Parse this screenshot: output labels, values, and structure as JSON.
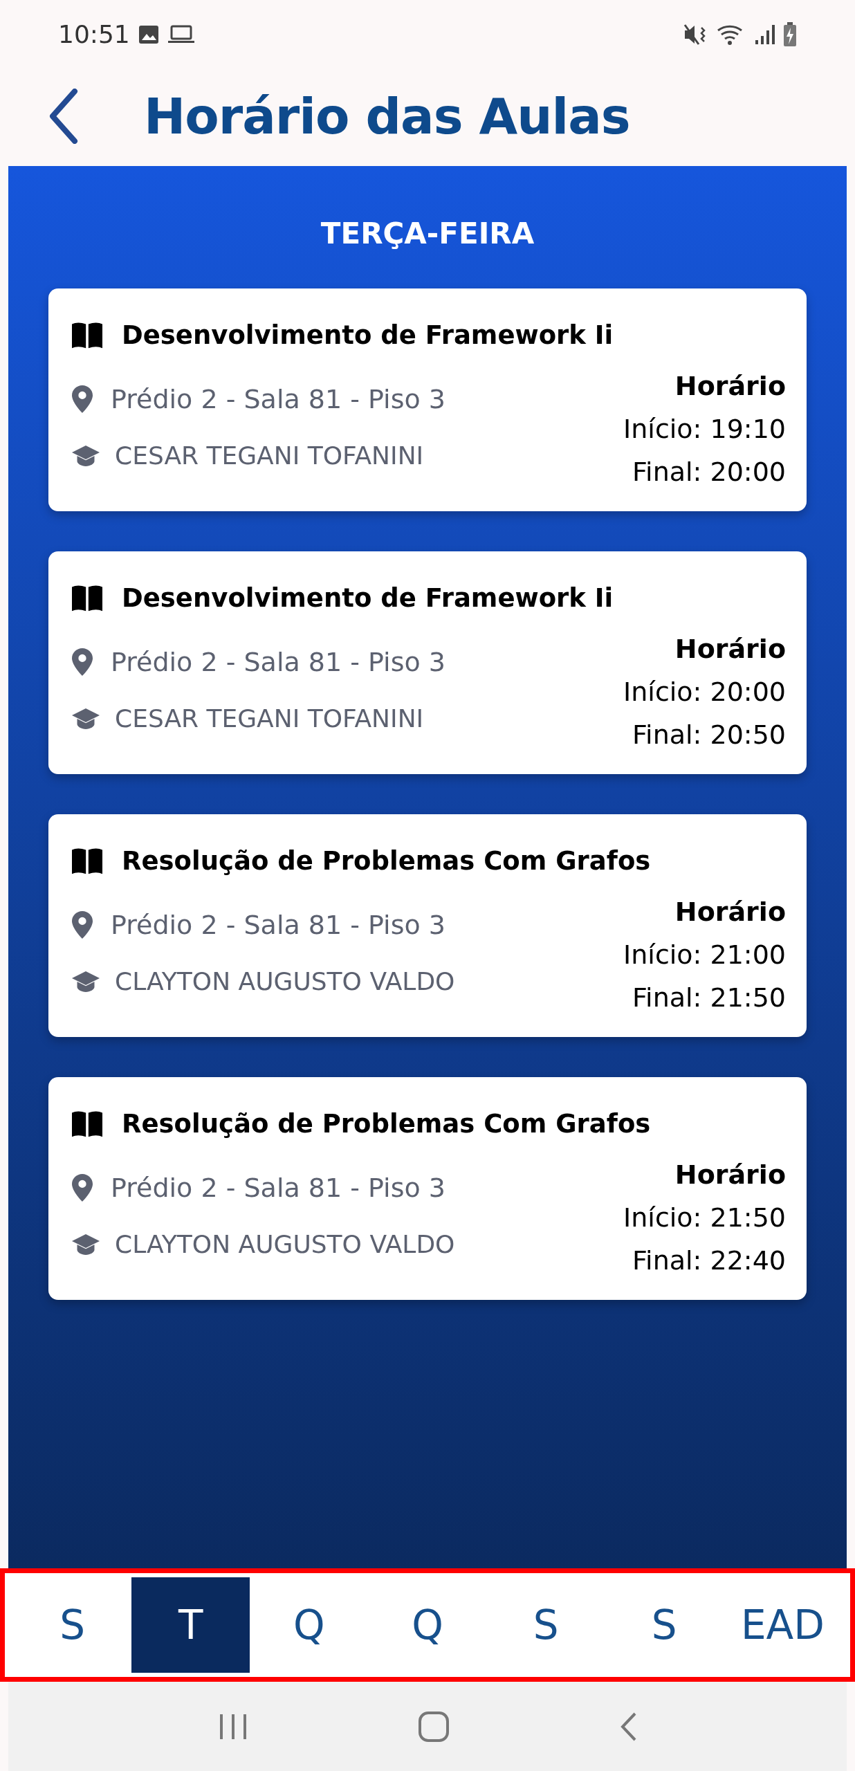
{
  "status_bar": {
    "time": "10:51"
  },
  "header": {
    "title": "Horário das Aulas"
  },
  "day_title": "TERÇA-FEIRA",
  "classes": [
    {
      "subject": "Desenvolvimento de Framework Ii",
      "location": "Prédio 2 - Sala 81 - Piso 3",
      "teacher": "CESAR TEGANI TOFANINI",
      "schedule_label": "Horário",
      "start": "Início: 19:10",
      "end": "Final: 20:00"
    },
    {
      "subject": "Desenvolvimento de Framework Ii",
      "location": "Prédio 2 - Sala 81 - Piso 3",
      "teacher": "CESAR TEGANI TOFANINI",
      "schedule_label": "Horário",
      "start": "Início: 20:00",
      "end": "Final: 20:50"
    },
    {
      "subject": "Resolução de Problemas Com Grafos",
      "location": "Prédio 2 - Sala 81 - Piso 3",
      "teacher": "CLAYTON AUGUSTO VALDO",
      "schedule_label": "Horário",
      "start": "Início: 21:00",
      "end": "Final: 21:50"
    },
    {
      "subject": "Resolução de Problemas Com Grafos",
      "location": "Prédio 2 - Sala 81 - Piso 3",
      "teacher": "CLAYTON AUGUSTO VALDO",
      "schedule_label": "Horário",
      "start": "Início: 21:50",
      "end": "Final: 22:40"
    }
  ],
  "day_tabs": [
    {
      "label": "S",
      "selected": false
    },
    {
      "label": "T",
      "selected": true
    },
    {
      "label": "Q",
      "selected": false
    },
    {
      "label": "Q",
      "selected": false
    },
    {
      "label": "S",
      "selected": false
    },
    {
      "label": "S",
      "selected": false
    },
    {
      "label": "EAD",
      "selected": false
    }
  ]
}
